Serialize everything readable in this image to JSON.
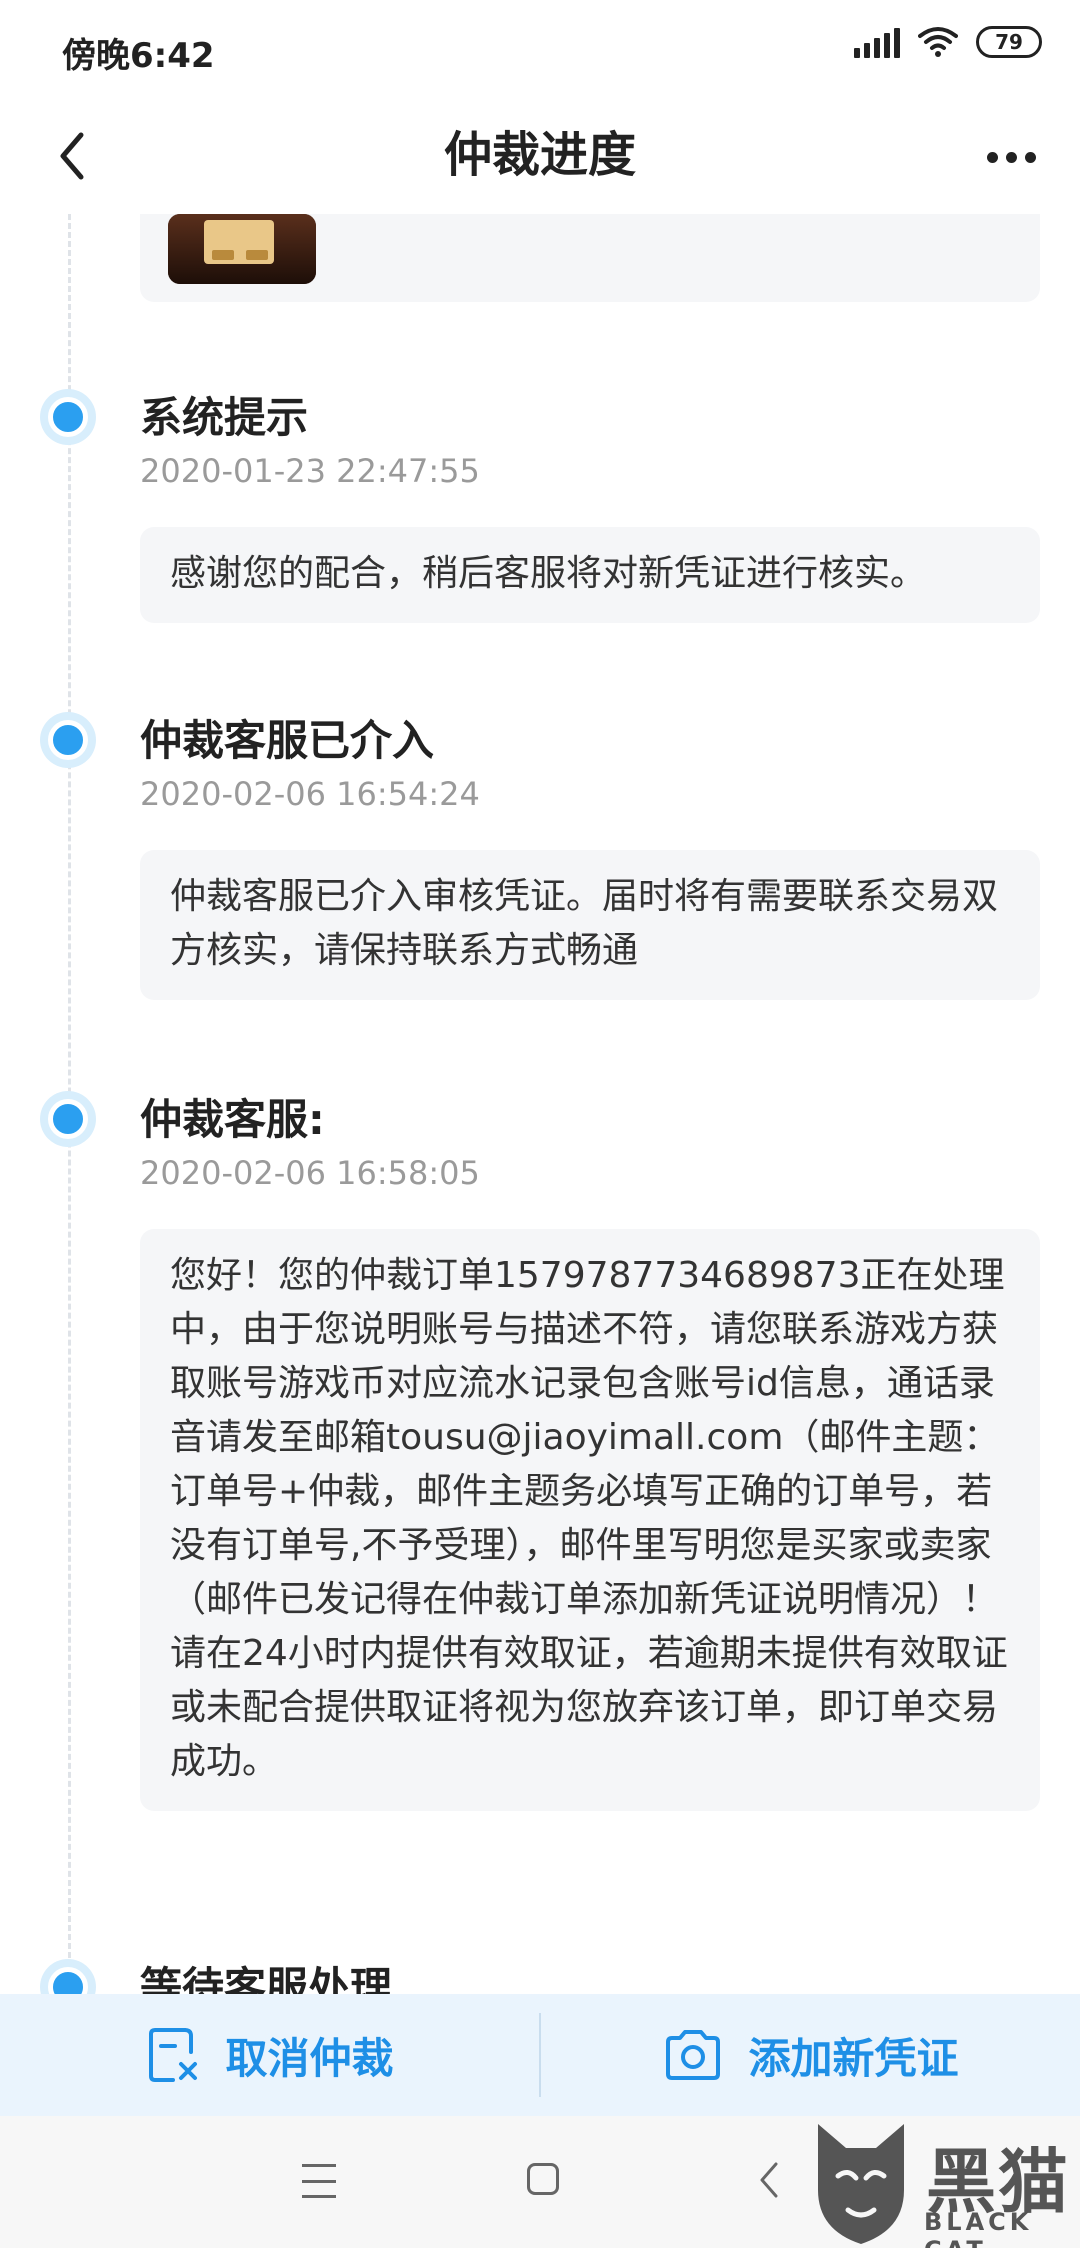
{
  "status_bar": {
    "time": "傍晚6:42",
    "battery": "79"
  },
  "header": {
    "title": "仲裁进度"
  },
  "events": [
    {
      "title": "系统提示",
      "time": "2020-01-23 22:47:55",
      "message": "感谢您的配合，稍后客服将对新凭证进行核实。"
    },
    {
      "title": "仲裁客服已介入",
      "time": "2020-02-06 16:54:24",
      "message": "仲裁客服已介入审核凭证。届时将有需要联系交易双方核实，请保持联系方式畅通"
    },
    {
      "title": "仲裁客服:",
      "time": "2020-02-06 16:58:05",
      "message": "您好！您的仲裁订单1579787734689873正在处理中，由于您说明账号与描述不符，请您联系游戏方获取账号游戏币对应流水记录包含账号id信息，通话录音请发至邮箱tousu@jiaoyimall.com（邮件主题：订单号+仲裁，邮件主题务必填写正确的订单号，若没有订单号,不予受理），邮件里写明您是买家或卖家（邮件已发记得在仲裁订单添加新凭证说明情况）！请在24小时内提供有效取证，若逾期未提供有效取证或未配合提供取证将视为您放弃该订单，即订单交易成功。"
    },
    {
      "title": "等待客服处理"
    }
  ],
  "actions": {
    "cancel_label": "取消仲裁",
    "add_label": "添加新凭证"
  },
  "icons": {
    "back": "chevron-left-icon",
    "more": "more-dots-icon",
    "cancel": "cancel-document-icon",
    "camera": "camera-icon"
  },
  "colors": {
    "accent": "#1e8fe6",
    "action_bar_bg": "#eaf4fd",
    "card_bg": "#f5f6f8"
  },
  "watermark": {
    "text": "黑猫",
    "sub": "BLACK CAT"
  }
}
